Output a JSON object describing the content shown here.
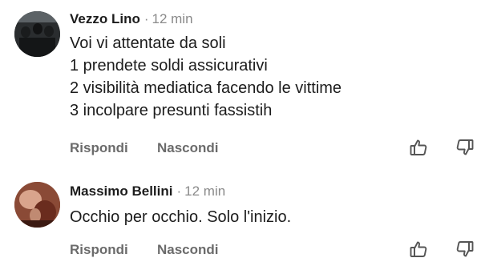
{
  "comments": [
    {
      "author": "Vezzo Lino",
      "separator": "·",
      "time": "12 min",
      "lines": [
        "Voi vi attentate da soli",
        "1 prendete soldi assicurativi",
        "2 visibilità mediatica facendo le vittime",
        "3 incolpare presunti fassistih"
      ],
      "reply_label": "Rispondi",
      "hide_label": "Nascondi"
    },
    {
      "author": "Massimo Bellini",
      "separator": "·",
      "time": "12 min",
      "lines": [
        "Occhio per occhio. Solo l'inizio."
      ],
      "reply_label": "Rispondi",
      "hide_label": "Nascondi"
    }
  ],
  "icons": {
    "like": "thumbs-up-icon",
    "dislike": "thumbs-down-icon"
  }
}
